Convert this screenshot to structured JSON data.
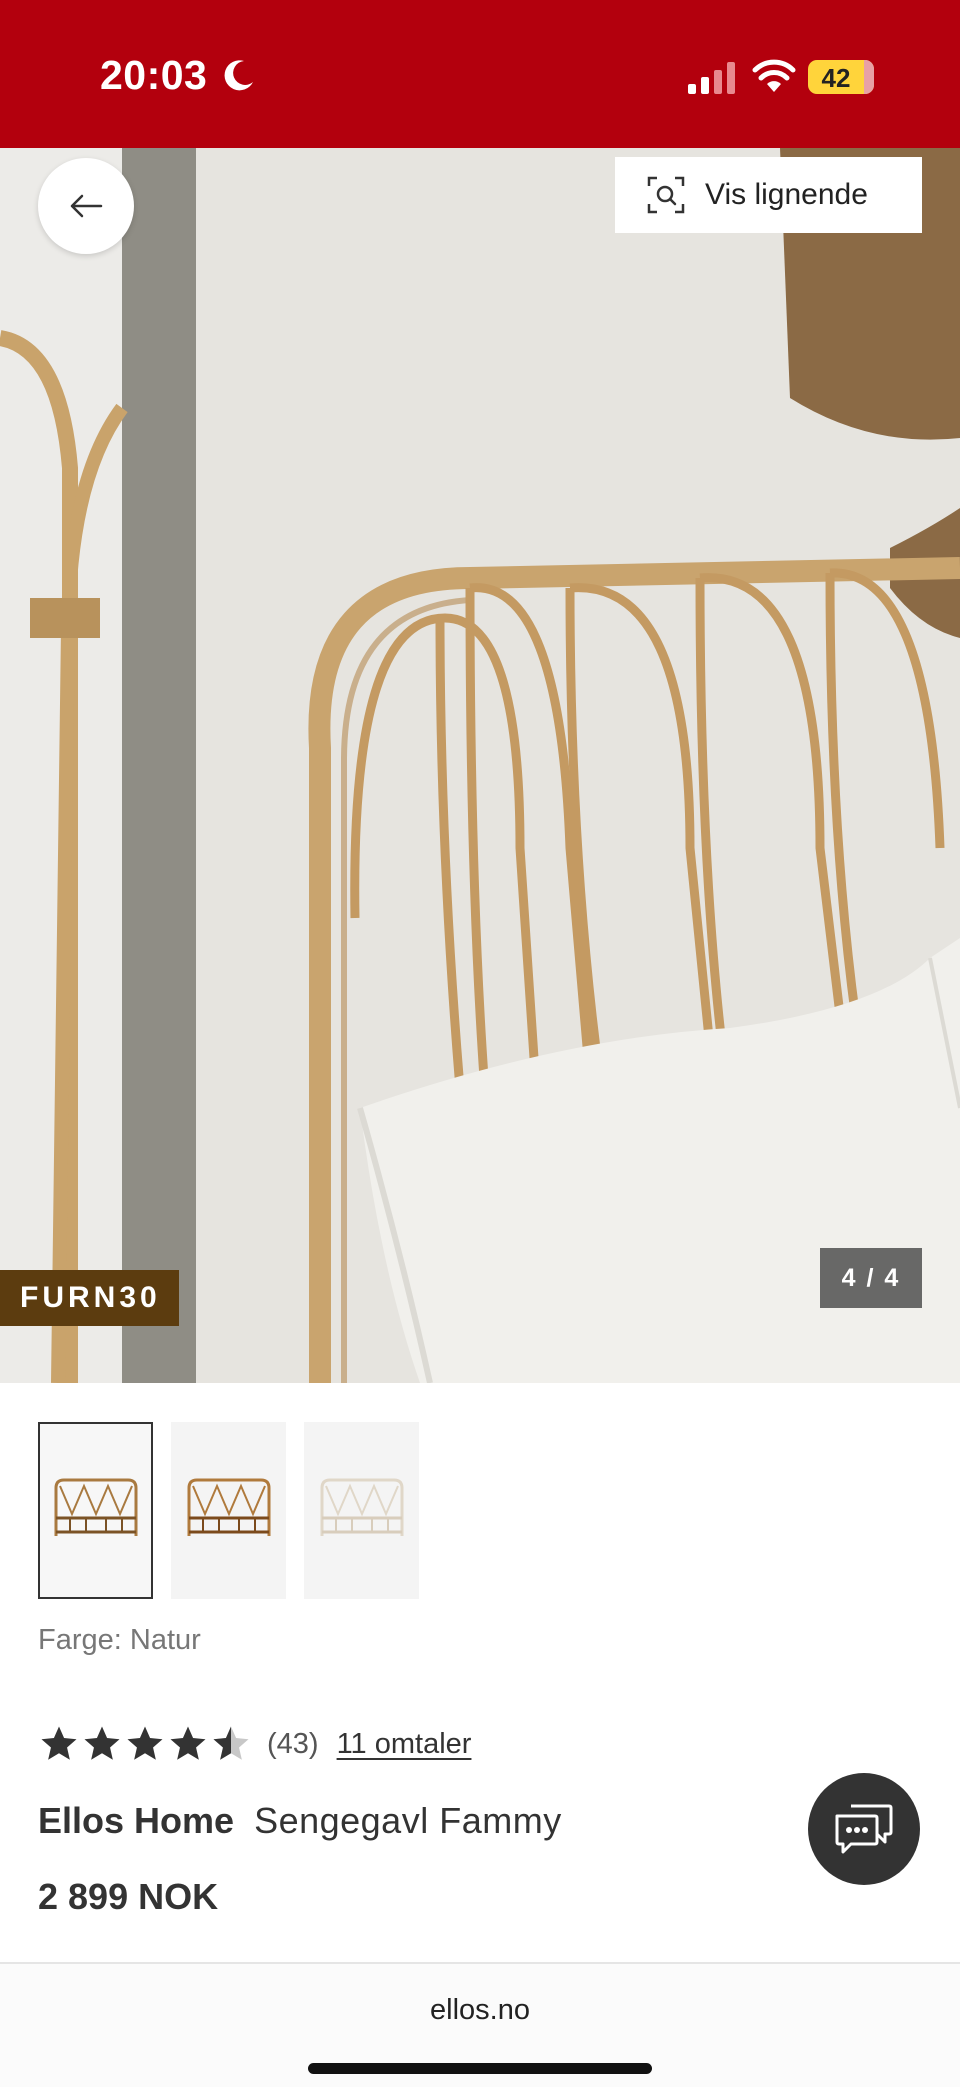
{
  "status_bar": {
    "time": "20:03",
    "battery": "42",
    "icons": [
      "moon-icon",
      "signal-icon",
      "wifi-icon",
      "battery-icon"
    ]
  },
  "gallery": {
    "similar_label": "Vis lignende",
    "promo_code": "FURN30",
    "counter": "4 / 4",
    "icons": [
      "back-arrow-icon",
      "visual-search-icon"
    ]
  },
  "thumbnails": [
    {
      "name": "thumb-1",
      "selected": true
    },
    {
      "name": "thumb-2",
      "selected": false
    },
    {
      "name": "thumb-3",
      "selected": false
    }
  ],
  "product": {
    "color_label": "Farge: Natur",
    "rating": 4.5,
    "rating_count": "(43)",
    "reviews_link": "11 omtaler",
    "brand": "Ellos Home",
    "name": "Sengegavl Fammy",
    "price": "2 899 NOK"
  },
  "browser": {
    "url": "ellos.no"
  },
  "colors": {
    "brand_red": "#b3000d",
    "promo_brown": "#5c3c0f",
    "battery_yellow": "#ffd43b"
  }
}
